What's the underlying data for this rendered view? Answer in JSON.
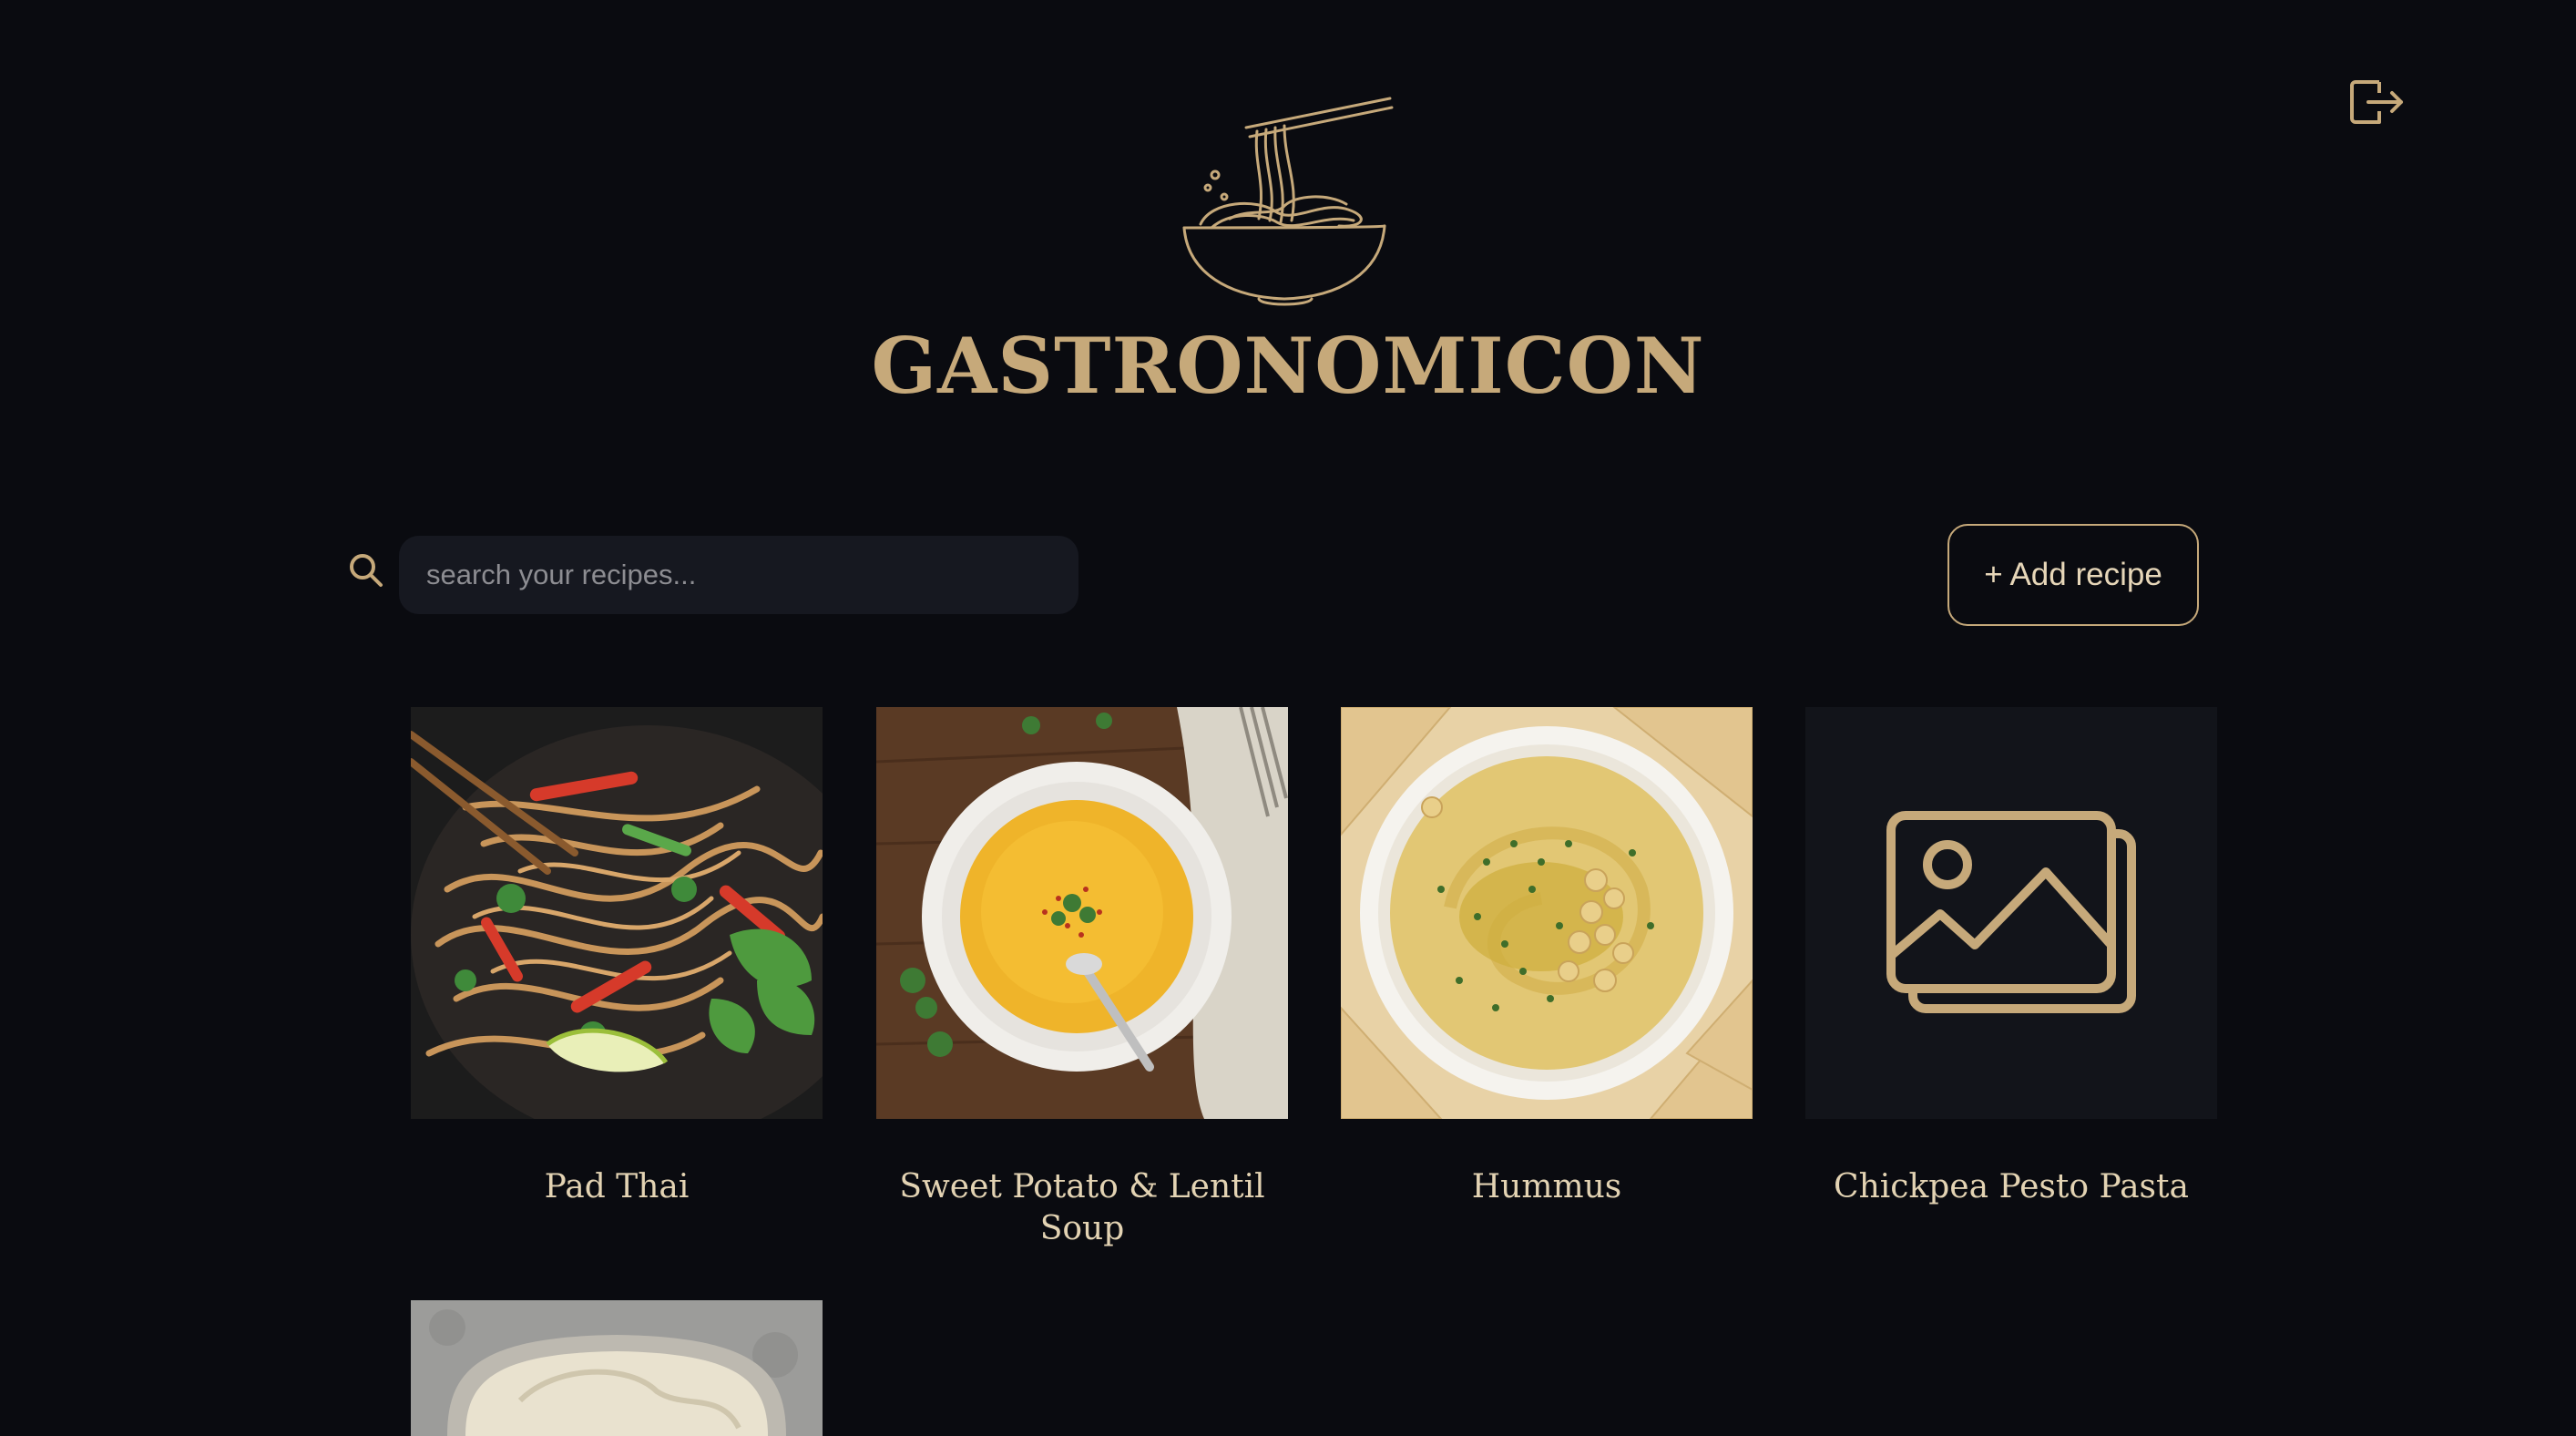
{
  "app": {
    "brand_name": "GASTRONOMICON",
    "logo_icon": "noodle-bowl-icon",
    "logout_icon": "logout-icon",
    "accent_color": "#c6a97a"
  },
  "toolbar": {
    "search_icon": "search-icon",
    "search_placeholder": "search your recipes...",
    "search_value": "",
    "add_label": "+ Add recipe"
  },
  "recipes": [
    {
      "title": "Pad Thai",
      "image": "pad-thai-photo"
    },
    {
      "title": "Sweet Potato & Lentil Soup",
      "image": "soup-photo"
    },
    {
      "title": "Hummus",
      "image": "hummus-photo"
    },
    {
      "title": "Chickpea Pesto Pasta",
      "image": "image-placeholder-icon"
    },
    {
      "title": "",
      "image": "jar-photo"
    }
  ]
}
